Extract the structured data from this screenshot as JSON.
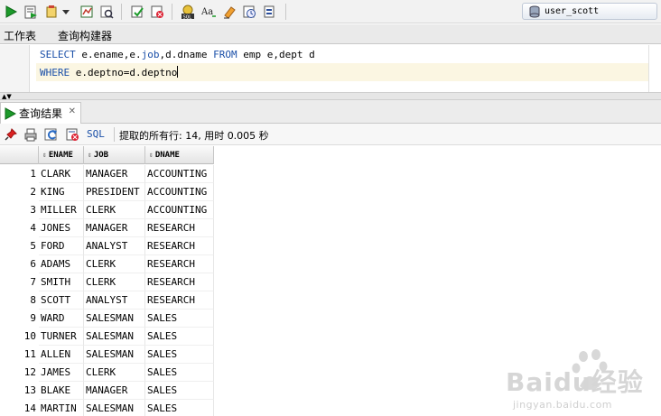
{
  "connection": {
    "user": "user_scott"
  },
  "tabs": [
    "工作表",
    "查询构建器"
  ],
  "editor": {
    "lines": [
      [
        {
          "t": "SELECT",
          "kw": true
        },
        {
          "t": " e.ename,e.",
          "kw": false
        },
        {
          "t": "job",
          "kw": true
        },
        {
          "t": ",d.dname ",
          "kw": false
        },
        {
          "t": "FROM",
          "kw": true
        },
        {
          "t": " emp e,dept d",
          "kw": false
        }
      ],
      [
        {
          "t": "WHERE",
          "kw": true
        },
        {
          "t": " e.deptno=d.deptno",
          "kw": false
        }
      ]
    ]
  },
  "results_tab": {
    "label": "查询结果"
  },
  "results_toolbar": {
    "sql_label": "SQL",
    "status": "提取的所有行: 14, 用时 0.005 秒"
  },
  "grid": {
    "columns": [
      "ENAME",
      "JOB",
      "DNAME"
    ],
    "rows": [
      [
        "1",
        "CLARK",
        "MANAGER",
        "ACCOUNTING"
      ],
      [
        "2",
        "KING",
        "PRESIDENT",
        "ACCOUNTING"
      ],
      [
        "3",
        "MILLER",
        "CLERK",
        "ACCOUNTING"
      ],
      [
        "4",
        "JONES",
        "MANAGER",
        "RESEARCH"
      ],
      [
        "5",
        "FORD",
        "ANALYST",
        "RESEARCH"
      ],
      [
        "6",
        "ADAMS",
        "CLERK",
        "RESEARCH"
      ],
      [
        "7",
        "SMITH",
        "CLERK",
        "RESEARCH"
      ],
      [
        "8",
        "SCOTT",
        "ANALYST",
        "RESEARCH"
      ],
      [
        "9",
        "WARD",
        "SALESMAN",
        "SALES"
      ],
      [
        "10",
        "TURNER",
        "SALESMAN",
        "SALES"
      ],
      [
        "11",
        "ALLEN",
        "SALESMAN",
        "SALES"
      ],
      [
        "12",
        "JAMES",
        "CLERK",
        "SALES"
      ],
      [
        "13",
        "BLAKE",
        "MANAGER",
        "SALES"
      ],
      [
        "14",
        "MARTIN",
        "SALESMAN",
        "SALES"
      ]
    ]
  },
  "watermark": {
    "brand": "Baidu经验",
    "sub": "jingyan.baidu.com"
  },
  "colors": {
    "keyword": "#1a4fa8",
    "run_green": "#1c9a2a",
    "highlight": "#fbf6e2"
  },
  "icons": {
    "toolbar": [
      "run-statement-icon",
      "run-script-icon",
      "commit-icon",
      "autotrace-icon",
      "explain-plan-icon",
      "commit-check-icon",
      "rollback-icon",
      "sql-tuning-icon",
      "format-case-icon",
      "clear-icon",
      "history-icon",
      "unshared-sql-icon"
    ],
    "results": [
      "pin-icon",
      "print-icon",
      "refresh-icon",
      "delete-icon"
    ]
  }
}
